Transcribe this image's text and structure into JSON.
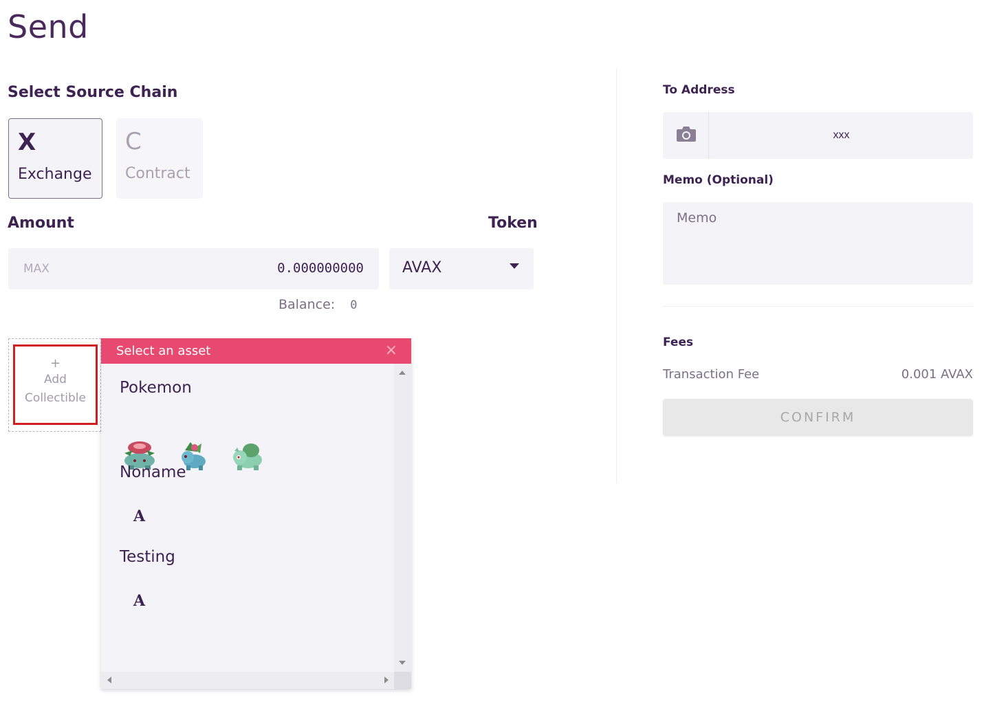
{
  "page": {
    "title": "Send"
  },
  "source_chain": {
    "label": "Select Source Chain",
    "options": [
      {
        "letter": "X",
        "name": "Exchange",
        "selected": true
      },
      {
        "letter": "C",
        "name": "Contract",
        "selected": false
      }
    ]
  },
  "amount": {
    "label": "Amount",
    "max_label": "MAX",
    "value": "0.000000000",
    "balance_label": "Balance:",
    "balance_value": "0"
  },
  "token": {
    "label": "Token",
    "selected": "AVAX"
  },
  "collectible": {
    "plus": "+",
    "line1": "Add",
    "line2": "Collectible"
  },
  "asset_popup": {
    "title": "Select an asset",
    "close": "×",
    "groups": [
      {
        "name": "Pokemon",
        "items": [
          "venusaur-icon",
          "ivysaur-icon",
          "bulbasaur-icon"
        ]
      },
      {
        "name": "Noname",
        "items": [
          "A"
        ]
      },
      {
        "name": "Testing",
        "items": [
          "A"
        ]
      }
    ]
  },
  "to_address": {
    "label": "To Address",
    "value": "xxx",
    "camera_icon": "camera-icon"
  },
  "memo": {
    "label": "Memo (Optional)",
    "placeholder": "Memo"
  },
  "fees": {
    "label": "Fees",
    "tx_fee_label": "Transaction Fee",
    "tx_fee_value": "0.001 AVAX"
  },
  "confirm": {
    "label": "CONFIRM",
    "enabled": false
  },
  "colors": {
    "accent": "#e84970",
    "primary_text": "#3e2352",
    "highlight_border": "#d11f1f"
  }
}
